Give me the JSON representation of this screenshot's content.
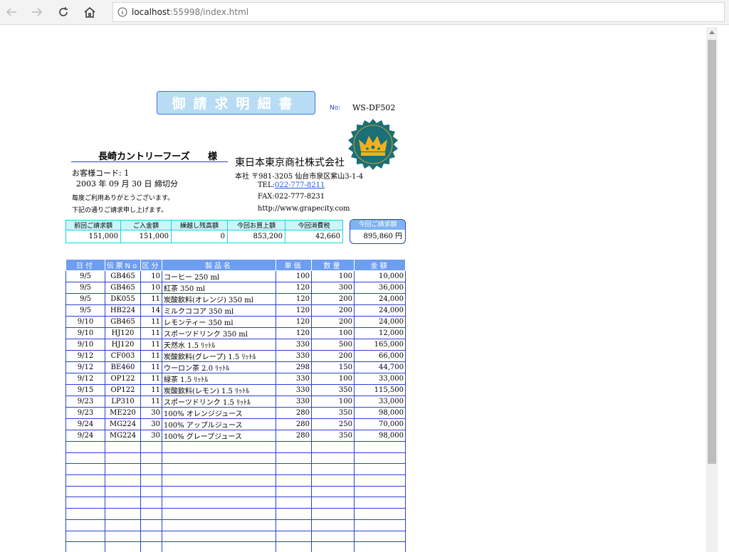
{
  "browser": {
    "url_host": "localhost",
    "url_path": ":55998/index.html"
  },
  "doc": {
    "title": "御請求明細書",
    "no_label": "No:",
    "no_value": "WS-DF502",
    "customer_name": "長崎カントリーフーズ",
    "honorific": "様",
    "customer_code": "お客様コード:  1",
    "closing_date": "2003 年  09 月  30 日 締切分",
    "message1": "毎度ご利用ありがとうございます。",
    "message2": "下記の通りご請求申し上げます。",
    "company": "東日本東京商社株式会社",
    "address": "本社  〒981-3205  仙台市泉区紫山3-1-4",
    "tel_label": "TEL:",
    "tel_value": "022-777-8211",
    "fax": "FAX:022-777-8231",
    "website": "http://www.grapecity.com"
  },
  "summary": {
    "headers": [
      "前回ご請求額",
      "ご入金額",
      "繰越し残高額",
      "今回お買上額",
      "今回消費税"
    ],
    "values": [
      "151,000",
      "151,000",
      "0",
      "853,200",
      "42,660"
    ],
    "bill_label": "今回ご請求額",
    "bill_value": "895,860 円"
  },
  "detail": {
    "headers": [
      "日付",
      "伝票No",
      "区分",
      "製品名",
      "単価",
      "数量",
      "金額"
    ],
    "rows": [
      [
        "9/5",
        "GB465",
        "10",
        "コーヒー 250 ml",
        "100",
        "100",
        "10,000"
      ],
      [
        "9/5",
        "GB465",
        "10",
        "紅茶 350 ml",
        "120",
        "300",
        "36,000"
      ],
      [
        "9/5",
        "DK055",
        "11",
        "炭酸飲料(オレンジ) 350 ml",
        "120",
        "200",
        "24,000"
      ],
      [
        "9/5",
        "HB224",
        "14",
        "ミルクココア 350 ml",
        "120",
        "200",
        "24,000"
      ],
      [
        "9/10",
        "GB465",
        "11",
        "レモンティー 350 ml",
        "120",
        "200",
        "24,000"
      ],
      [
        "9/10",
        "HJ120",
        "11",
        "スポーツドリンク 350 ml",
        "120",
        "100",
        "12,000"
      ],
      [
        "9/10",
        "HJ120",
        "11",
        "天然水 1.5 ﾘｯﾄﾙ",
        "330",
        "500",
        "165,000"
      ],
      [
        "9/12",
        "CF003",
        "11",
        "炭酸飲料(グレープ) 1.5 ﾘｯﾄﾙ",
        "330",
        "200",
        "66,000"
      ],
      [
        "9/12",
        "BE460",
        "11",
        "ウーロン茶 2.0 ﾘｯﾄﾙ",
        "298",
        "150",
        "44,700"
      ],
      [
        "9/12",
        "OP122",
        "11",
        "緑茶 1.5 ﾘｯﾄﾙ",
        "330",
        "100",
        "33,000"
      ],
      [
        "9/15",
        "OP122",
        "11",
        "炭酸飲料(レモン) 1.5 ﾘｯﾄﾙ",
        "330",
        "350",
        "115,500"
      ],
      [
        "9/23",
        "LP310",
        "11",
        "スポーツドリンク 1.5 ﾘｯﾄﾙ",
        "330",
        "100",
        "33,000"
      ],
      [
        "9/23",
        "ME220",
        "30",
        "100% オレンジジュース",
        "280",
        "350",
        "98,000"
      ],
      [
        "9/24",
        "MG224",
        "30",
        "100% アップルジュース",
        "280",
        "250",
        "70,000"
      ],
      [
        "9/24",
        "MG224",
        "30",
        "100% グレープジュース",
        "280",
        "350",
        "98,000"
      ]
    ]
  },
  "colors": {
    "accent": "#2b3fd6",
    "header_fill": "#6e9ef0",
    "summary_fill": "#cdf5f8",
    "emblem_green": "#1b6f76",
    "emblem_gold": "#f1b11c"
  },
  "icons": {
    "back": "arrow-left-icon",
    "forward": "arrow-right-icon",
    "refresh": "refresh-icon",
    "home": "home-icon",
    "info": "info-icon",
    "emblem": "crown-emblem-icon"
  }
}
